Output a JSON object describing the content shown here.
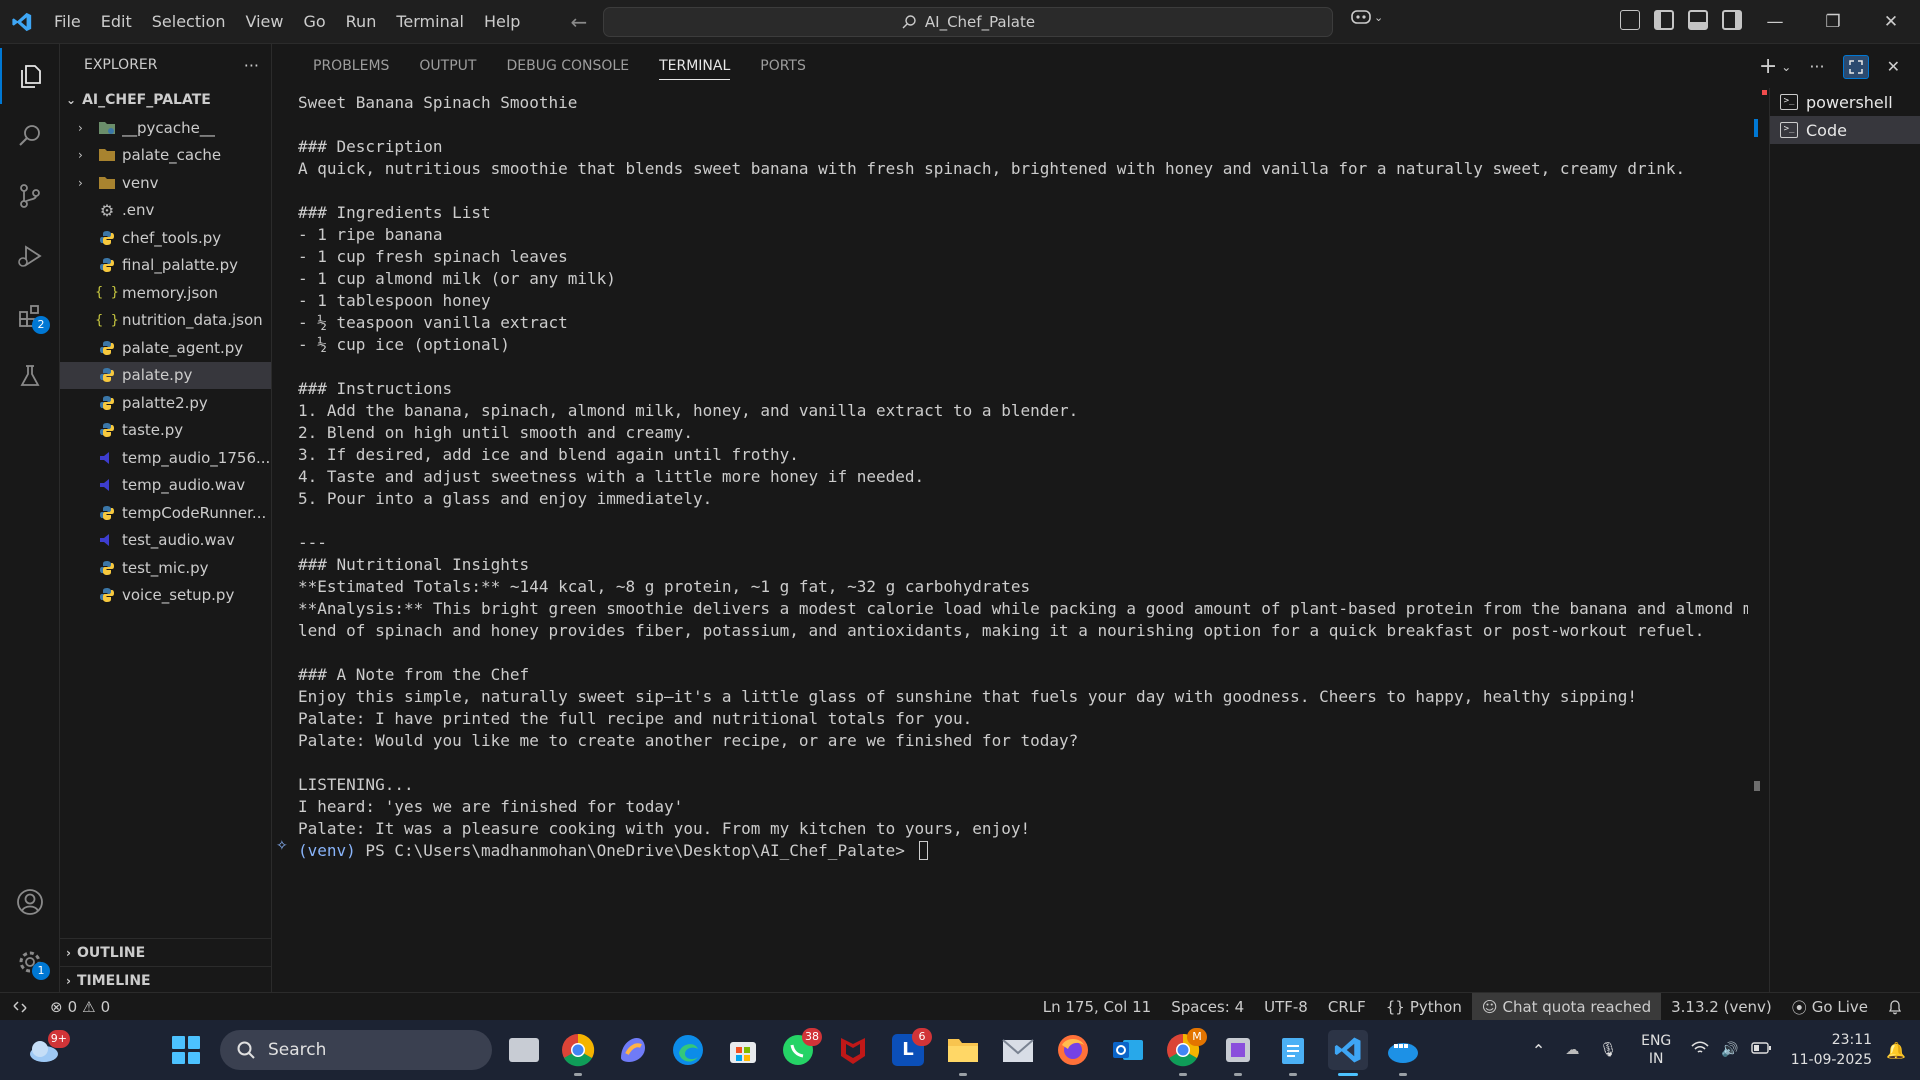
{
  "window": {
    "title": "AI_Chef_Palate",
    "menu": [
      "File",
      "Edit",
      "Selection",
      "View",
      "Go",
      "Run",
      "Terminal",
      "Help"
    ]
  },
  "activity_bar": {
    "extensions_badge": "2",
    "settings_badge": "1"
  },
  "explorer": {
    "header": "EXPLORER",
    "more": "···",
    "project": "AI_CHEF_PALATE",
    "folders": [
      {
        "name": "__pycache__",
        "icon": "python-folder-icon"
      },
      {
        "name": "palate_cache",
        "icon": "folder-icon"
      },
      {
        "name": "venv",
        "icon": "folder-icon"
      }
    ],
    "files": [
      {
        "name": ".env",
        "icon": "gear-icon"
      },
      {
        "name": "chef_tools.py",
        "icon": "python-icon"
      },
      {
        "name": "final_palatte.py",
        "icon": "python-icon"
      },
      {
        "name": "memory.json",
        "icon": "json-icon"
      },
      {
        "name": "nutrition_data.json",
        "icon": "json-icon"
      },
      {
        "name": "palate_agent.py",
        "icon": "python-icon"
      },
      {
        "name": "palate.py",
        "icon": "python-icon",
        "selected": true
      },
      {
        "name": "palatte2.py",
        "icon": "python-icon"
      },
      {
        "name": "taste.py",
        "icon": "python-icon"
      },
      {
        "name": "temp_audio_1756...",
        "icon": "audio-icon"
      },
      {
        "name": "temp_audio.wav",
        "icon": "audio-icon"
      },
      {
        "name": "tempCodeRunner...",
        "icon": "python-icon"
      },
      {
        "name": "test_audio.wav",
        "icon": "audio-icon"
      },
      {
        "name": "test_mic.py",
        "icon": "python-icon"
      },
      {
        "name": "voice_setup.py",
        "icon": "python-icon"
      }
    ],
    "outline": "OUTLINE",
    "timeline": "TIMELINE"
  },
  "panel": {
    "tabs": [
      "PROBLEMS",
      "OUTPUT",
      "DEBUG CONSOLE",
      "TERMINAL",
      "PORTS"
    ],
    "active_tab": "TERMINAL",
    "terminal_lines": [
      "Sweet Banana Spinach Smoothie",
      "",
      "### Description",
      "A quick, nutritious smoothie that blends sweet banana with fresh spinach, brightened with honey and vanilla for a naturally sweet, creamy drink.",
      "",
      "### Ingredients List",
      "- 1 ripe banana",
      "- 1 cup fresh spinach leaves",
      "- 1 cup almond milk (or any milk)",
      "- 1 tablespoon honey",
      "- ½ teaspoon vanilla extract",
      "- ½ cup ice (optional)",
      "",
      "### Instructions",
      "1. Add the banana, spinach, almond milk, honey, and vanilla extract to a blender.",
      "2. Blend on high until smooth and creamy.",
      "3. If desired, add ice and blend again until frothy.",
      "4. Taste and adjust sweetness with a little more honey if needed.",
      "5. Pour into a glass and enjoy immediately.",
      "",
      "---",
      "### Nutritional Insights",
      "**Estimated Totals:** ~144 kcal, ~8 g protein, ~1 g fat, ~32 g carbohydrates",
      "**Analysis:** This bright green smoothie delivers a modest calorie load while packing a good amount of plant-based protein from the banana and almond milk. The b",
      "lend of spinach and honey provides fiber, potassium, and antioxidants, making it a nourishing option for a quick breakfast or post-workout refuel.",
      "",
      "### A Note from the Chef",
      "Enjoy this simple, naturally sweet sip—it's a little glass of sunshine that fuels your day with goodness. Cheers to happy, healthy sipping!",
      "Palate: I have printed the full recipe and nutritional totals for you.",
      "Palate: Would you like me to create another recipe, or are we finished for today?",
      "",
      "LISTENING...",
      "I heard: 'yes we are finished for today'",
      "Palate: It was a pleasure cooking with you. From my kitchen to yours, enjoy!"
    ],
    "prompt_venv": "(venv)",
    "prompt_path": " PS C:\\Users\\madhanmohan\\OneDrive\\Desktop\\AI_Chef_Palate> ",
    "terminals": [
      {
        "name": "powershell",
        "active": false
      },
      {
        "name": "Code",
        "active": true
      }
    ]
  },
  "statusbar": {
    "errors": "0",
    "warnings": "0",
    "position": "Ln 175, Col 11",
    "spaces": "Spaces: 4",
    "encoding": "UTF-8",
    "eol": "CRLF",
    "language": "Python",
    "chat": "Chat quota reached",
    "interpreter": "3.13.2 (venv)",
    "golive": "Go Live"
  },
  "taskbar": {
    "weather_badge": "9+",
    "search_label": "Search",
    "whatsapp_badge": "38",
    "l_badge": "6",
    "chrome_badge": "M",
    "lang_line1": "ENG",
    "lang_line2": "IN",
    "time": "23:11",
    "date": "11-09-2025"
  },
  "colors": {
    "accent": "#0078d4",
    "editor_bg": "#181818",
    "taskbar_bg": "#1c2333"
  }
}
